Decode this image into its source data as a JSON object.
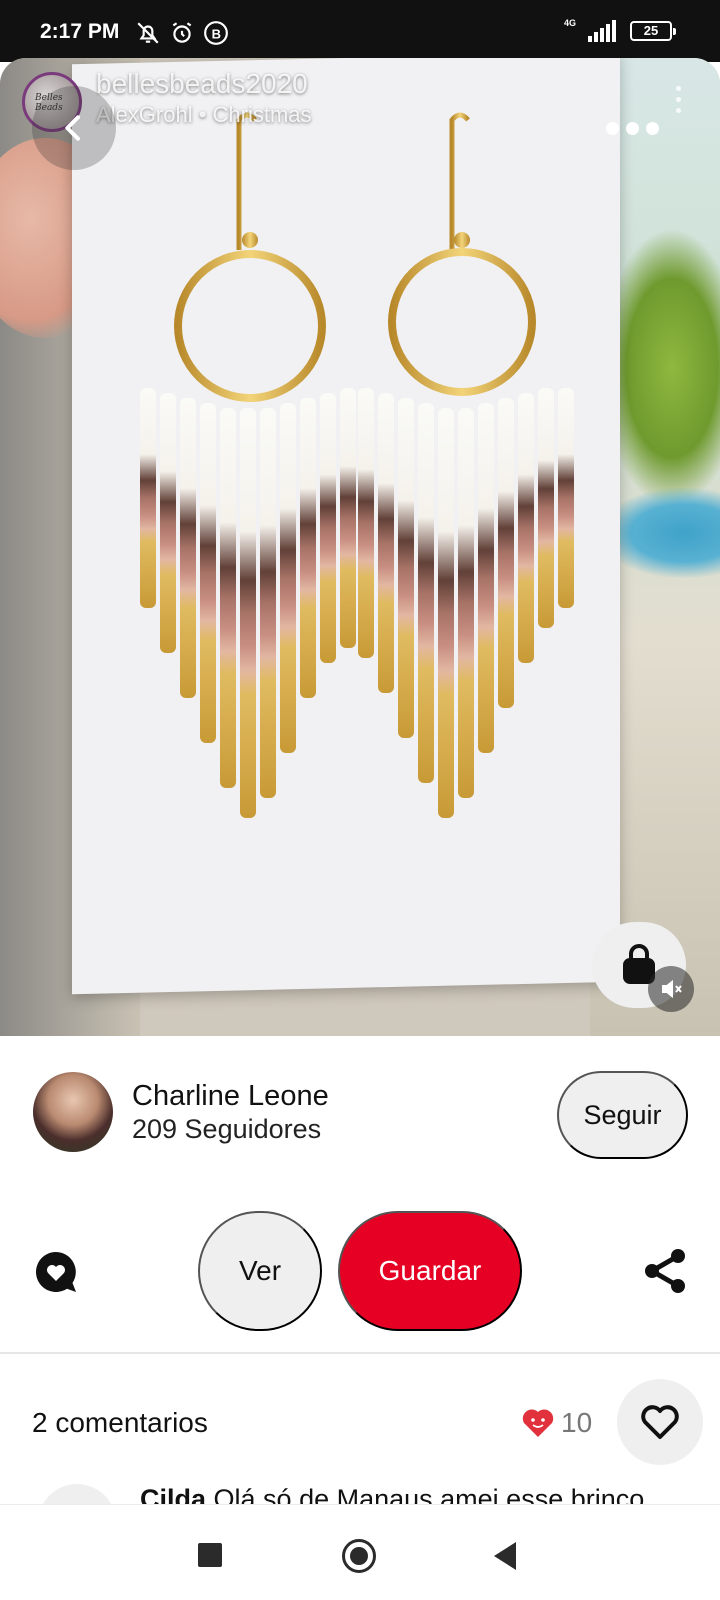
{
  "status_bar": {
    "time": "2:17 PM",
    "network_label": "4G",
    "battery_level": "25"
  },
  "pin_overlay": {
    "board_owner": "bellesbeads2020",
    "board_subtitle": "AlexGrohl • Christmas",
    "logo_text": "Belles Beads"
  },
  "creator": {
    "name": "Charline Leone",
    "followers": "209 Seguidores",
    "follow_label": "Seguir"
  },
  "actions": {
    "view_label": "Ver",
    "save_label": "Guardar"
  },
  "comments": {
    "count_label": "2 comentarios",
    "reaction_count": "10",
    "preview_author": "Cilda",
    "preview_text": "Olá só de Manaus amei esse brinco"
  },
  "colors": {
    "save_red": "#e60023",
    "chip_grey": "#efefef",
    "reaction_red": "#e0313d"
  },
  "icons": [
    "back-arrow-icon",
    "more-icon",
    "shopping-bag-icon",
    "mute-icon",
    "comment-heart-icon",
    "share-icon",
    "heart-reaction-icon",
    "heart-outline-icon",
    "recents-icon",
    "home-icon",
    "back-nav-icon"
  ]
}
